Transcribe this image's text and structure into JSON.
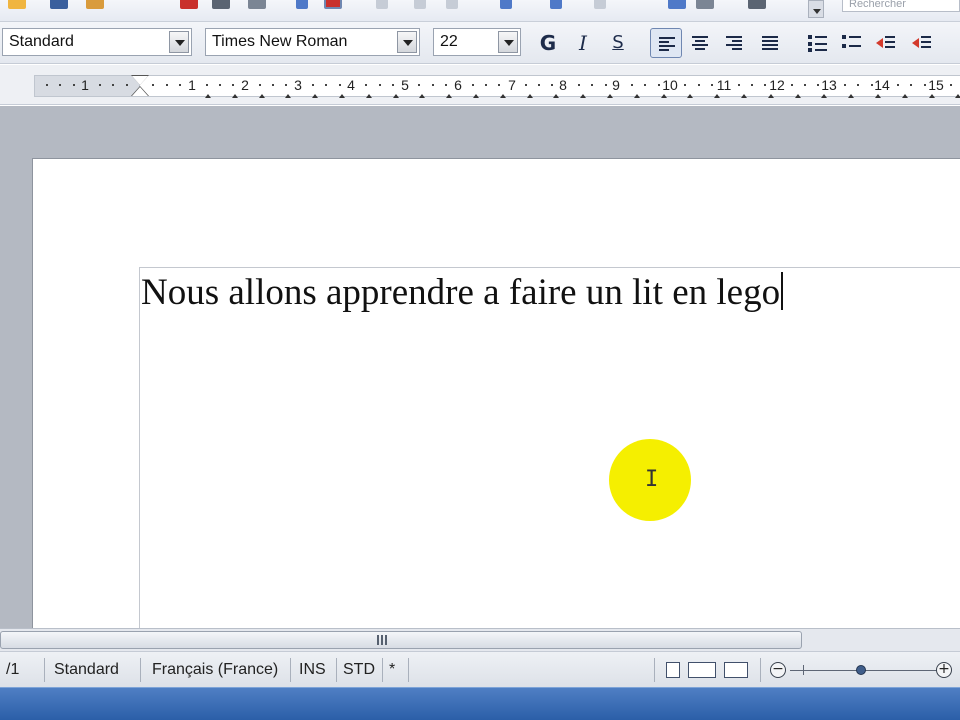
{
  "toolbar": {
    "search_placeholder": "Rechercher"
  },
  "format_toolbar": {
    "paragraph_style": "Standard",
    "font_name": "Times New Roman",
    "font_size": "22",
    "bold_label": "G",
    "italic_label": "I",
    "underline_label": "S"
  },
  "ruler": {
    "numbers": [
      "1",
      "1",
      "2",
      "3",
      "4",
      "5",
      "6",
      "7",
      "8",
      "9",
      "10",
      "11",
      "12",
      "13",
      "14",
      "15"
    ]
  },
  "document": {
    "text": "Nous allons apprendre a faire un lit en lego"
  },
  "cursor": {
    "glyph": "I"
  },
  "scrollbar": {
    "grip": "III"
  },
  "status_bar": {
    "page_count": "/1",
    "page_style": "Standard",
    "language": "Français (France)",
    "insert_mode": "INS",
    "selection_mode": "STD",
    "modified": "*",
    "zoom_out": "−",
    "zoom_in": "+"
  },
  "colors": {
    "highlight": "#f5ef00",
    "taskbar": "#2b5fa8",
    "page_background": "#b4b9c2"
  }
}
